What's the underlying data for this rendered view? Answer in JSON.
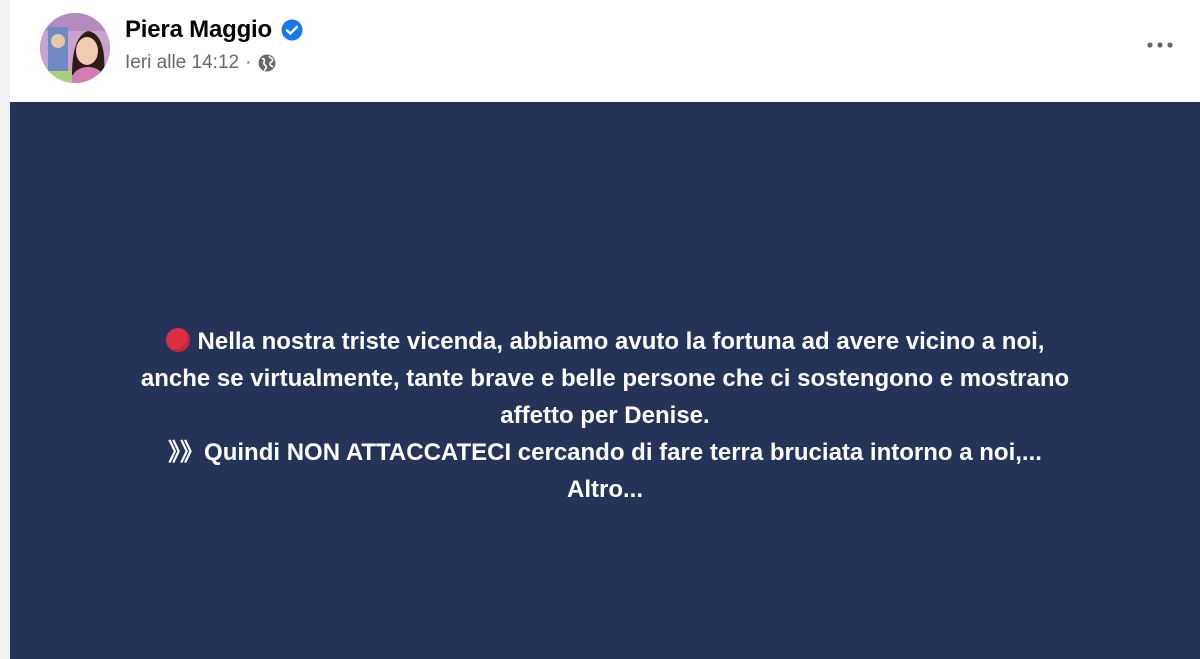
{
  "post": {
    "author": "Piera Maggio",
    "timestamp": "Ieri alle 14:12",
    "separator": "·",
    "audience_icon": "globe-icon",
    "verified_icon": "verified-badge-icon",
    "more_icon": "more-options-icon",
    "background_color": "#253359",
    "emoji_icon": "red-circle-icon",
    "text_lines": [
      "Nella nostra triste vicenda, abbiamo avuto la fortuna ad avere vicino a noi,",
      "anche se virtualmente, tante brave e belle persone che ci sostengono e mostrano",
      "affetto per Denise.",
      "》》Quindi NON ATTACCATECI cercando di fare terra bruciata intorno a noi,..."
    ],
    "see_more": "Altro..."
  },
  "colors": {
    "verified_blue": "#1877f2",
    "text_secondary": "#65676b",
    "emoji_red": "#dd2e44"
  }
}
